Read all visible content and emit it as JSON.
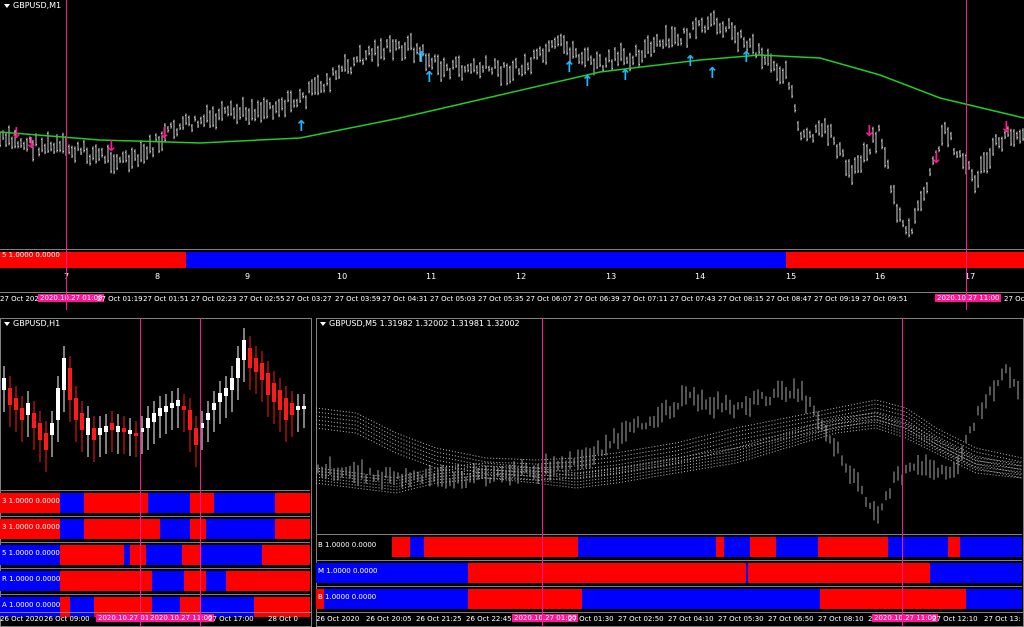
{
  "colors": {
    "bull": "#ffffff",
    "bear": "#ff1a1a",
    "ma": "#22cc22",
    "buy": "#1eb4ff",
    "sell": "#ff1493",
    "red": "#ff0000",
    "blue": "#0000ff",
    "vline": "#ff1493"
  },
  "top": {
    "title": "GBPUSD,M1",
    "indicator_label": "5 1.0000 0.0000",
    "numbers": [
      "7",
      "8",
      "9",
      "10",
      "11",
      "12",
      "13",
      "14",
      "15",
      "16",
      "17"
    ],
    "time_labels": [
      "27 Oct 2020",
      "2020.10.27 01:00",
      "27 Oct 01:19",
      "27 Oct 01:51",
      "27 Oct 02:23",
      "27 Oct 02:55",
      "27 Oct 03:27",
      "27 Oct 03:59",
      "27 Oct 04:31",
      "27 Oct 05:03",
      "27 Oct 05:35",
      "27 Oct 06:07",
      "27 Oct 06:39",
      "27 Oct 07:11",
      "27 Oct 07:43",
      "27 Oct 08:15",
      "27 Oct 08:47",
      "27 Oct 09:19",
      "27 Oct 09:51",
      "2020.10.27 11:00",
      "27 Oc"
    ],
    "buy_arrows": 8,
    "sell_arrows": 6
  },
  "left": {
    "title": "GBPUSD,H1",
    "indicators": [
      {
        "label": "3 1.0000 0.0000",
        "pattern": [
          [
            "red",
            0,
            60
          ],
          [
            "blue",
            60,
            84
          ],
          [
            "red",
            84,
            148
          ],
          [
            "blue",
            148,
            190
          ],
          [
            "red",
            190,
            214
          ],
          [
            "blue",
            214,
            275
          ],
          [
            "red",
            275,
            310
          ]
        ]
      },
      {
        "label": "3 1.0000 0.0000",
        "pattern": [
          [
            "red",
            0,
            60
          ],
          [
            "blue",
            60,
            84
          ],
          [
            "red",
            84,
            160
          ],
          [
            "blue",
            160,
            190
          ],
          [
            "red",
            190,
            206
          ],
          [
            "blue",
            206,
            275
          ],
          [
            "red",
            275,
            310
          ]
        ]
      },
      {
        "label": "5 1.0000 0.0000",
        "pattern": [
          [
            "blue",
            0,
            60
          ],
          [
            "red",
            60,
            70
          ],
          [
            "red",
            70,
            124
          ],
          [
            "blue",
            124,
            130
          ],
          [
            "red",
            130,
            146
          ],
          [
            "blue",
            146,
            182
          ],
          [
            "red",
            182,
            200
          ],
          [
            "blue",
            200,
            262
          ],
          [
            "red",
            262,
            310
          ]
        ]
      },
      {
        "label": "R 1.0000 0.0000",
        "pattern": [
          [
            "blue",
            0,
            60
          ],
          [
            "red",
            60,
            70
          ],
          [
            "red",
            70,
            152
          ],
          [
            "blue",
            152,
            184
          ],
          [
            "red",
            184,
            206
          ],
          [
            "blue",
            206,
            226
          ],
          [
            "red",
            226,
            310
          ]
        ]
      },
      {
        "label": "A 1.0000 0.0000",
        "pattern": [
          [
            "blue",
            0,
            60
          ],
          [
            "red",
            60,
            70
          ],
          [
            "blue",
            70,
            94
          ],
          [
            "red",
            94,
            152
          ],
          [
            "blue",
            152,
            180
          ],
          [
            "red",
            180,
            200
          ],
          [
            "blue",
            200,
            254
          ],
          [
            "red",
            254,
            310
          ]
        ]
      }
    ],
    "time_labels": [
      "26 Oct 2020",
      "26 Oct 09:00",
      "2020.10.27 01:00",
      "2020.10.27 11:00",
      "27 Oct 17:00",
      "28 Oct 0"
    ]
  },
  "right": {
    "title": "GBPUSD,M5  1.31982 1.32002 1.31981 1.32002",
    "indicators": [
      {
        "label": "B 1.0000 0.0000",
        "pattern": [
          [
            "red",
            76,
            94
          ],
          [
            "blue",
            94,
            108
          ],
          [
            "red",
            108,
            262
          ],
          [
            "blue",
            262,
            400
          ],
          [
            "red",
            400,
            408
          ],
          [
            "blue",
            408,
            434
          ],
          [
            "red",
            434,
            460
          ],
          [
            "blue",
            460,
            502
          ],
          [
            "red",
            502,
            572
          ],
          [
            "blue",
            572,
            632
          ],
          [
            "red",
            632,
            644
          ],
          [
            "blue",
            644,
            706
          ]
        ]
      },
      {
        "label": "M 1.0000 0.0000",
        "pattern": [
          [
            "blue",
            0,
            152
          ],
          [
            "red",
            152,
            430
          ],
          [
            "blue",
            430,
            432
          ],
          [
            "red",
            432,
            614
          ],
          [
            "blue",
            614,
            706
          ]
        ]
      },
      {
        "label": "B 1.0000 0.0000",
        "pattern": [
          [
            "red",
            0,
            8
          ],
          [
            "blue",
            8,
            152
          ],
          [
            "red",
            152,
            266
          ],
          [
            "blue",
            266,
            504
          ],
          [
            "red",
            504,
            650
          ],
          [
            "blue",
            650,
            706
          ]
        ]
      }
    ],
    "time_labels": [
      "26 Oct 2020",
      "26 Oct 20:05",
      "26 Oct 21:25",
      "26 Oct 22:45",
      "2020.10.27 01:00",
      "27 Oct 01:30",
      "27 Oct 02:50",
      "27 Oct 04:10",
      "27 Oct 05:30",
      "27 Oct 06:50",
      "27 Oct 08:10",
      "27 Oct 09:30",
      "2020.10.27 11:00",
      "27 Oct 12:10",
      "27 Oct 13:"
    ]
  }
}
